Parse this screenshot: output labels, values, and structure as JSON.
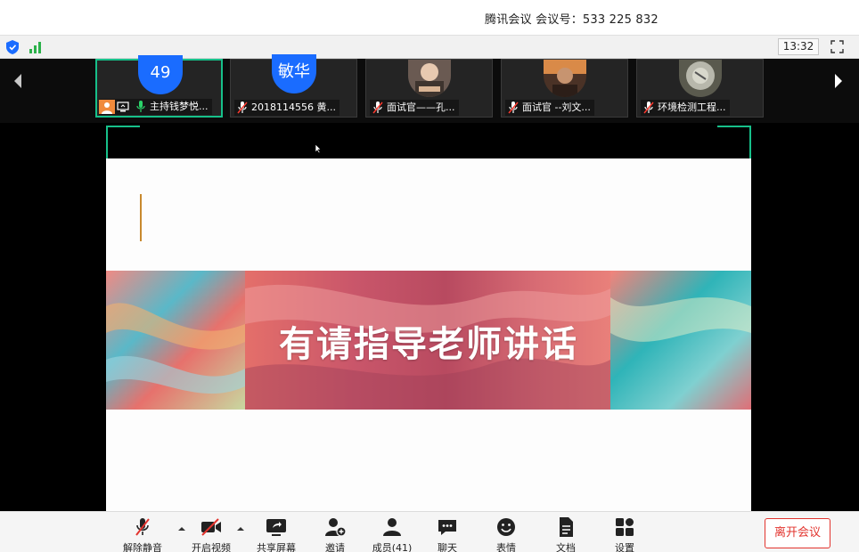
{
  "window": {
    "title": "腾讯会议 会议号：533 225 832"
  },
  "status": {
    "clock": "13:32"
  },
  "participants": [
    {
      "avatar_text": "49",
      "name": "主持钱梦悦...",
      "avatar": "circle"
    },
    {
      "avatar_text": "敏华",
      "name": "2018114556 黄...",
      "avatar": "circle"
    },
    {
      "avatar_text": "",
      "name": "面试官——孔...",
      "avatar": "photo"
    },
    {
      "avatar_text": "",
      "name": "面试官 --刘文...",
      "avatar": "photo"
    },
    {
      "avatar_text": "",
      "name": "环境检测工程...",
      "avatar": "photo"
    }
  ],
  "slide": {
    "banner_title": "有请指导老师讲话"
  },
  "toolbar": {
    "unmute": "解除静音",
    "start_video": "开启视频",
    "share_screen": "共享屏幕",
    "invite": "邀请",
    "members": "成员(41)",
    "chat": "聊天",
    "emoji": "表情",
    "docs": "文档",
    "settings": "设置",
    "leave": "离开会议"
  },
  "colors": {
    "accent_green": "#17c08a",
    "avatar_blue": "#1a6cff",
    "leave_red": "#e2342e"
  }
}
